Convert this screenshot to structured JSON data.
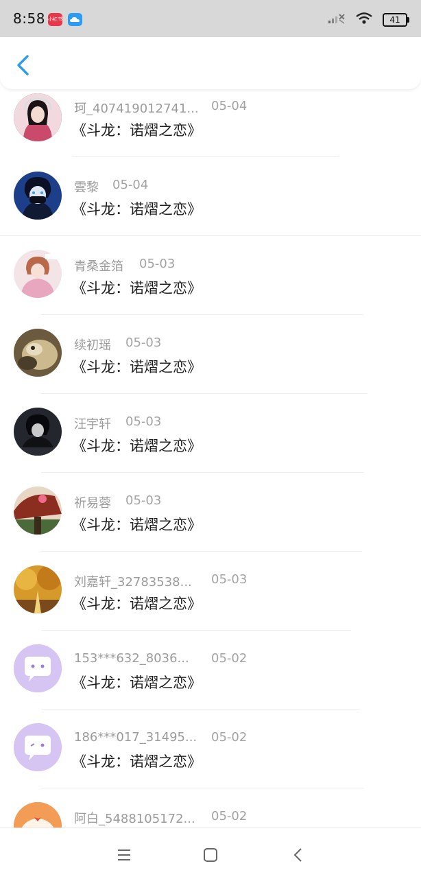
{
  "status_bar": {
    "time": "8:58",
    "app_badge_text": "小红书",
    "battery": "41",
    "icons": [
      "xiaohongshu-app-icon",
      "cloud-app-icon",
      "no-signal-icon",
      "wifi-icon",
      "battery-icon"
    ]
  },
  "header": {
    "back_icon": "chevron-left-icon",
    "accent_color": "#2d9cf0"
  },
  "comments": [
    {
      "username": "珂_407419012741...",
      "date": "05-04",
      "message": "《斗龙：诺熠之恋》"
    },
    {
      "username": "雲黎",
      "date": "05-04",
      "message": "《斗龙：诺熠之恋》"
    },
    {
      "username": "青桑金箔",
      "date": "05-03",
      "message": "《斗龙：诺熠之恋》"
    },
    {
      "username": "续初瑶",
      "date": "05-03",
      "message": "《斗龙：诺熠之恋》"
    },
    {
      "username": "汪宇轩",
      "date": "05-03",
      "message": "《斗龙：诺熠之恋》"
    },
    {
      "username": "祈易蓉",
      "date": "05-03",
      "message": "《斗龙：诺熠之恋》"
    },
    {
      "username": "刘嘉轩_32783538...",
      "date": "05-03",
      "message": "《斗龙：诺熠之恋》"
    },
    {
      "username": "153***632_8036...",
      "date": "05-02",
      "message": "《斗龙：诺熠之恋》"
    },
    {
      "username": "186***017_31495...",
      "date": "05-02",
      "message": "《斗龙：诺熠之恋》"
    },
    {
      "username": "阿白_5488105172...",
      "date": "05-02",
      "message": ""
    }
  ],
  "nav_bar": {
    "icons": [
      "menu-icon",
      "home-square-icon",
      "back-triangle-icon"
    ]
  }
}
